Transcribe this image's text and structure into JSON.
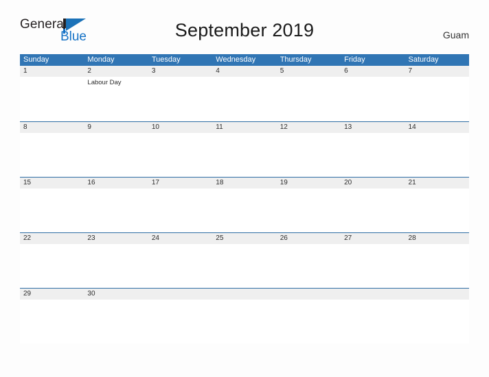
{
  "brand": {
    "name_line1": "General",
    "name_line2": "Blue",
    "flag_icon": "flag-triangle-icon",
    "color_dark": "#231f20",
    "color_blue": "#1572c6"
  },
  "header": {
    "title": "September 2019",
    "location": "Guam"
  },
  "theme": {
    "header_blue": "#3075b4",
    "row_divider_blue": "#2e6da4",
    "date_band_gray": "#efefef",
    "cell_white": "#ffffff",
    "page_background": "#fdfdfd"
  },
  "calendar": {
    "weekdays": [
      "Sunday",
      "Monday",
      "Tuesday",
      "Wednesday",
      "Thursday",
      "Friday",
      "Saturday"
    ],
    "weeks": [
      {
        "days": [
          {
            "date": "1",
            "events": []
          },
          {
            "date": "2",
            "events": [
              "Labour Day"
            ]
          },
          {
            "date": "3",
            "events": []
          },
          {
            "date": "4",
            "events": []
          },
          {
            "date": "5",
            "events": []
          },
          {
            "date": "6",
            "events": []
          },
          {
            "date": "7",
            "events": []
          }
        ]
      },
      {
        "days": [
          {
            "date": "8",
            "events": []
          },
          {
            "date": "9",
            "events": []
          },
          {
            "date": "10",
            "events": []
          },
          {
            "date": "11",
            "events": []
          },
          {
            "date": "12",
            "events": []
          },
          {
            "date": "13",
            "events": []
          },
          {
            "date": "14",
            "events": []
          }
        ]
      },
      {
        "days": [
          {
            "date": "15",
            "events": []
          },
          {
            "date": "16",
            "events": []
          },
          {
            "date": "17",
            "events": []
          },
          {
            "date": "18",
            "events": []
          },
          {
            "date": "19",
            "events": []
          },
          {
            "date": "20",
            "events": []
          },
          {
            "date": "21",
            "events": []
          }
        ]
      },
      {
        "days": [
          {
            "date": "22",
            "events": []
          },
          {
            "date": "23",
            "events": []
          },
          {
            "date": "24",
            "events": []
          },
          {
            "date": "25",
            "events": []
          },
          {
            "date": "26",
            "events": []
          },
          {
            "date": "27",
            "events": []
          },
          {
            "date": "28",
            "events": []
          }
        ]
      },
      {
        "days": [
          {
            "date": "29",
            "events": []
          },
          {
            "date": "30",
            "events": []
          },
          {
            "date": "",
            "events": []
          },
          {
            "date": "",
            "events": []
          },
          {
            "date": "",
            "events": []
          },
          {
            "date": "",
            "events": []
          },
          {
            "date": "",
            "events": []
          }
        ]
      }
    ]
  }
}
